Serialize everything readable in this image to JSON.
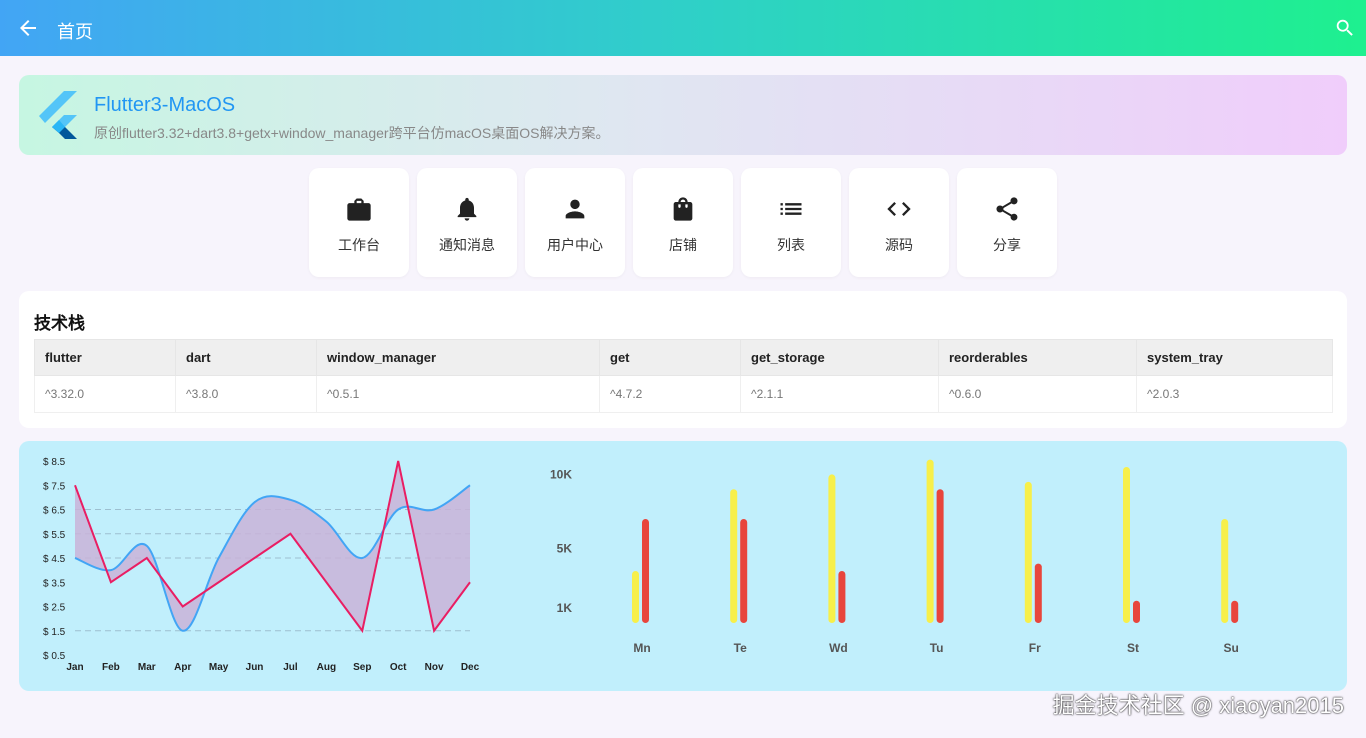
{
  "appbar": {
    "title": "首页",
    "back_icon": "arrow-left-icon",
    "search_icon": "search-icon"
  },
  "banner": {
    "title": "Flutter3-MacOS",
    "subtitle": "原创flutter3.32+dart3.8+getx+window_manager跨平台仿macOS桌面OS解决方案。",
    "logo": "flutter-logo"
  },
  "nav_items": [
    {
      "label": "工作台",
      "icon": "briefcase-icon"
    },
    {
      "label": "通知消息",
      "icon": "bell-icon"
    },
    {
      "label": "用户中心",
      "icon": "person-icon"
    },
    {
      "label": "店铺",
      "icon": "shopping-bag-icon"
    },
    {
      "label": "列表",
      "icon": "list-icon"
    },
    {
      "label": "源码",
      "icon": "code-icon"
    },
    {
      "label": "分享",
      "icon": "share-icon"
    }
  ],
  "tech_stack": {
    "title": "技术栈",
    "columns": [
      "flutter",
      "dart",
      "window_manager",
      "get",
      "get_storage",
      "reorderables",
      "system_tray"
    ],
    "values": [
      "^3.32.0",
      "^3.8.0",
      "^0.5.1",
      "^4.7.2",
      "^2.1.1",
      "^0.6.0",
      "^2.0.3"
    ]
  },
  "chart_data": [
    {
      "type": "line",
      "categories": [
        "Jan",
        "Feb",
        "Mar",
        "Apr",
        "May",
        "Jun",
        "Jul",
        "Aug",
        "Sep",
        "Oct",
        "Nov",
        "Dec"
      ],
      "y_tick_labels": [
        "$ 0.5",
        "$ 1.5",
        "$ 2.5",
        "$ 3.5",
        "$ 4.5",
        "$ 5.5",
        "$ 6.5",
        "$ 7.5",
        "$ 8.5"
      ],
      "ylim": [
        0.5,
        8.5
      ],
      "dashed_gridlines": [
        1.5,
        4.5,
        5.5,
        6.5
      ],
      "series": [
        {
          "color": "#42a5f5",
          "smooth": true,
          "values": [
            4.5,
            4.0,
            5.0,
            1.5,
            4.5,
            6.8,
            6.9,
            6.0,
            4.5,
            6.5,
            6.5,
            7.5
          ]
        },
        {
          "color": "#e91e63",
          "smooth": false,
          "values": [
            7.5,
            3.5,
            4.5,
            2.5,
            3.5,
            4.5,
            5.5,
            3.5,
            1.5,
            8.5,
            1.5,
            3.5
          ]
        }
      ],
      "fill_between_color": "#c9b3d8"
    },
    {
      "type": "bar",
      "categories": [
        "Mn",
        "Te",
        "Wd",
        "Tu",
        "Fr",
        "St",
        "Su"
      ],
      "y_tick_labels": [
        "1K",
        "5K",
        "10K"
      ],
      "y_tick_values": [
        1,
        5,
        10
      ],
      "ylim": [
        0,
        10.5
      ],
      "series": [
        {
          "color": "#f7ef4a",
          "values": [
            3.5,
            9.0,
            10.0,
            11.0,
            9.5,
            10.5,
            7.0
          ]
        },
        {
          "color": "#e8453c",
          "values": [
            7.0,
            7.0,
            3.5,
            9.0,
            4.0,
            1.5,
            1.5
          ]
        }
      ]
    }
  ],
  "watermark": "掘金技术社区 @ xiaoyan2015"
}
